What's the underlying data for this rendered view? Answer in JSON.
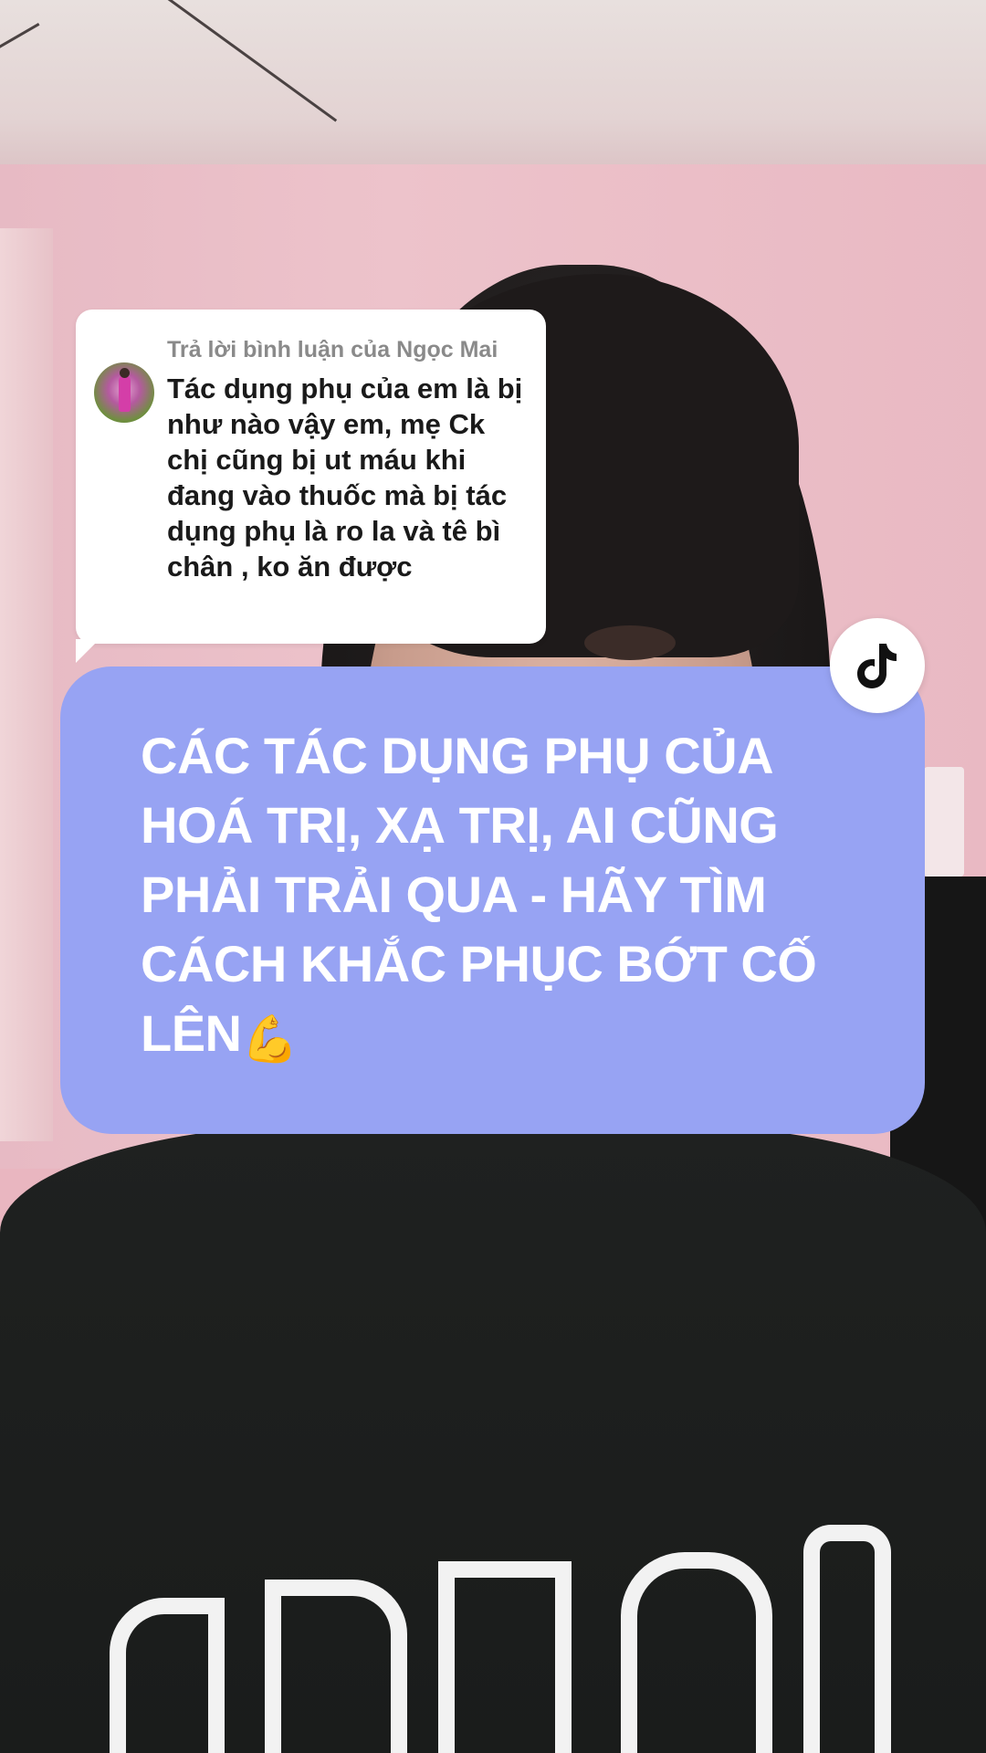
{
  "reply": {
    "header": "Trả lời bình luận của Ngọc Mai",
    "comment": "Tác dụng phụ của em là bị như nào vậy em, mẹ Ck chị cũng bị ut máu khi đang vào thuốc mà bị tác dụng phụ là ro la và tê bì chân , ko ăn được",
    "avatar_icon": "user-avatar"
  },
  "caption": {
    "text": "CÁC TÁC DỤNG PHỤ CỦA HOÁ TRỊ, XẠ TRỊ, AI CŨNG PHẢI TRẢI QUA - HÃY TÌM CÁCH KHẮC PHỤC BỚT CỐ LÊN",
    "emoji": "💪",
    "background_color": "#97a3f3",
    "text_color": "#ffffff"
  },
  "badge": {
    "icon": "tiktok-logo-icon"
  }
}
